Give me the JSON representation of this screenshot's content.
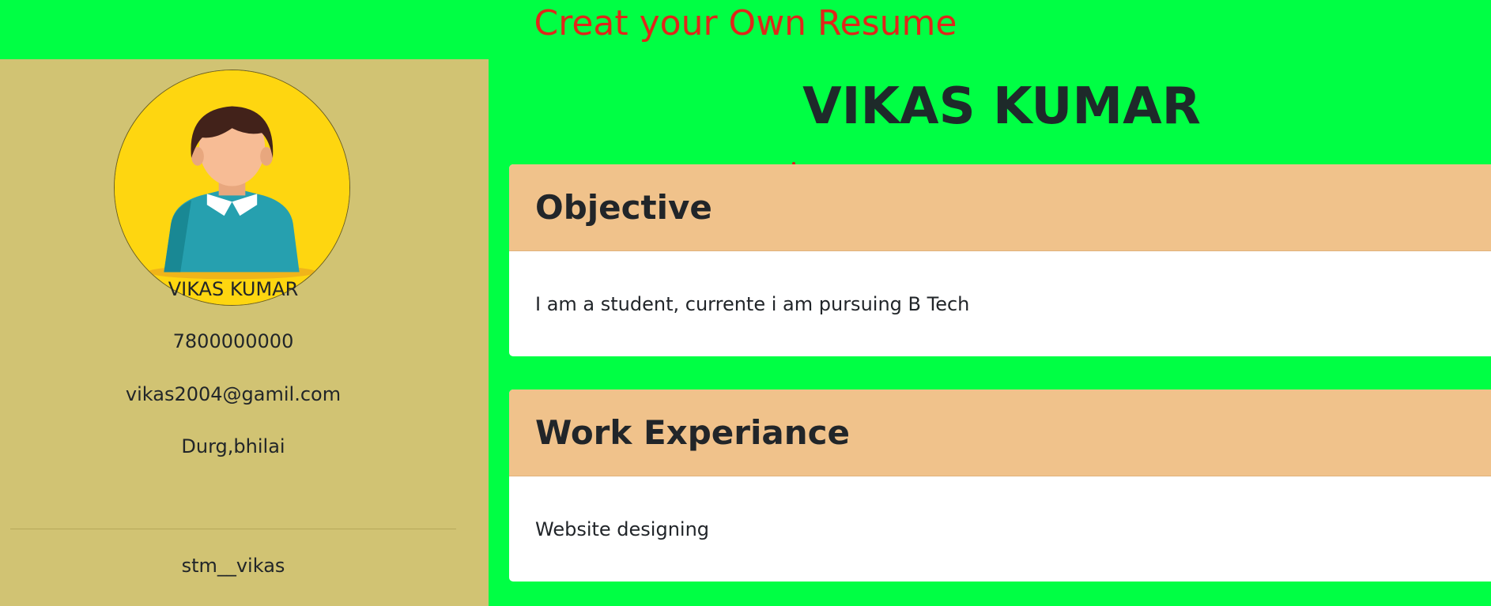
{
  "header": {
    "title": "Creat your Own Resume"
  },
  "sidebar": {
    "avatar_icon": "person-avatar-icon",
    "name": "VIKAS KUMAR",
    "phone": "7800000000",
    "email": "vikas2004@gamil.com",
    "location": "Durg,bhilai",
    "handle": "stm__vikas"
  },
  "main": {
    "name": "VIKAS KUMAR",
    "sections": [
      {
        "title": "Objective",
        "body": "I am a student, currente i am pursuing B Tech"
      },
      {
        "title": "Work Experiance",
        "body": "Website designing"
      }
    ]
  },
  "colors": {
    "page_background": "#00ff44",
    "title_color": "#e0261a",
    "sidebar_background": "#d1c373",
    "card_header_background": "#f0c28b",
    "card_body_background": "#ffffff",
    "avatar_background": "#fed610"
  }
}
